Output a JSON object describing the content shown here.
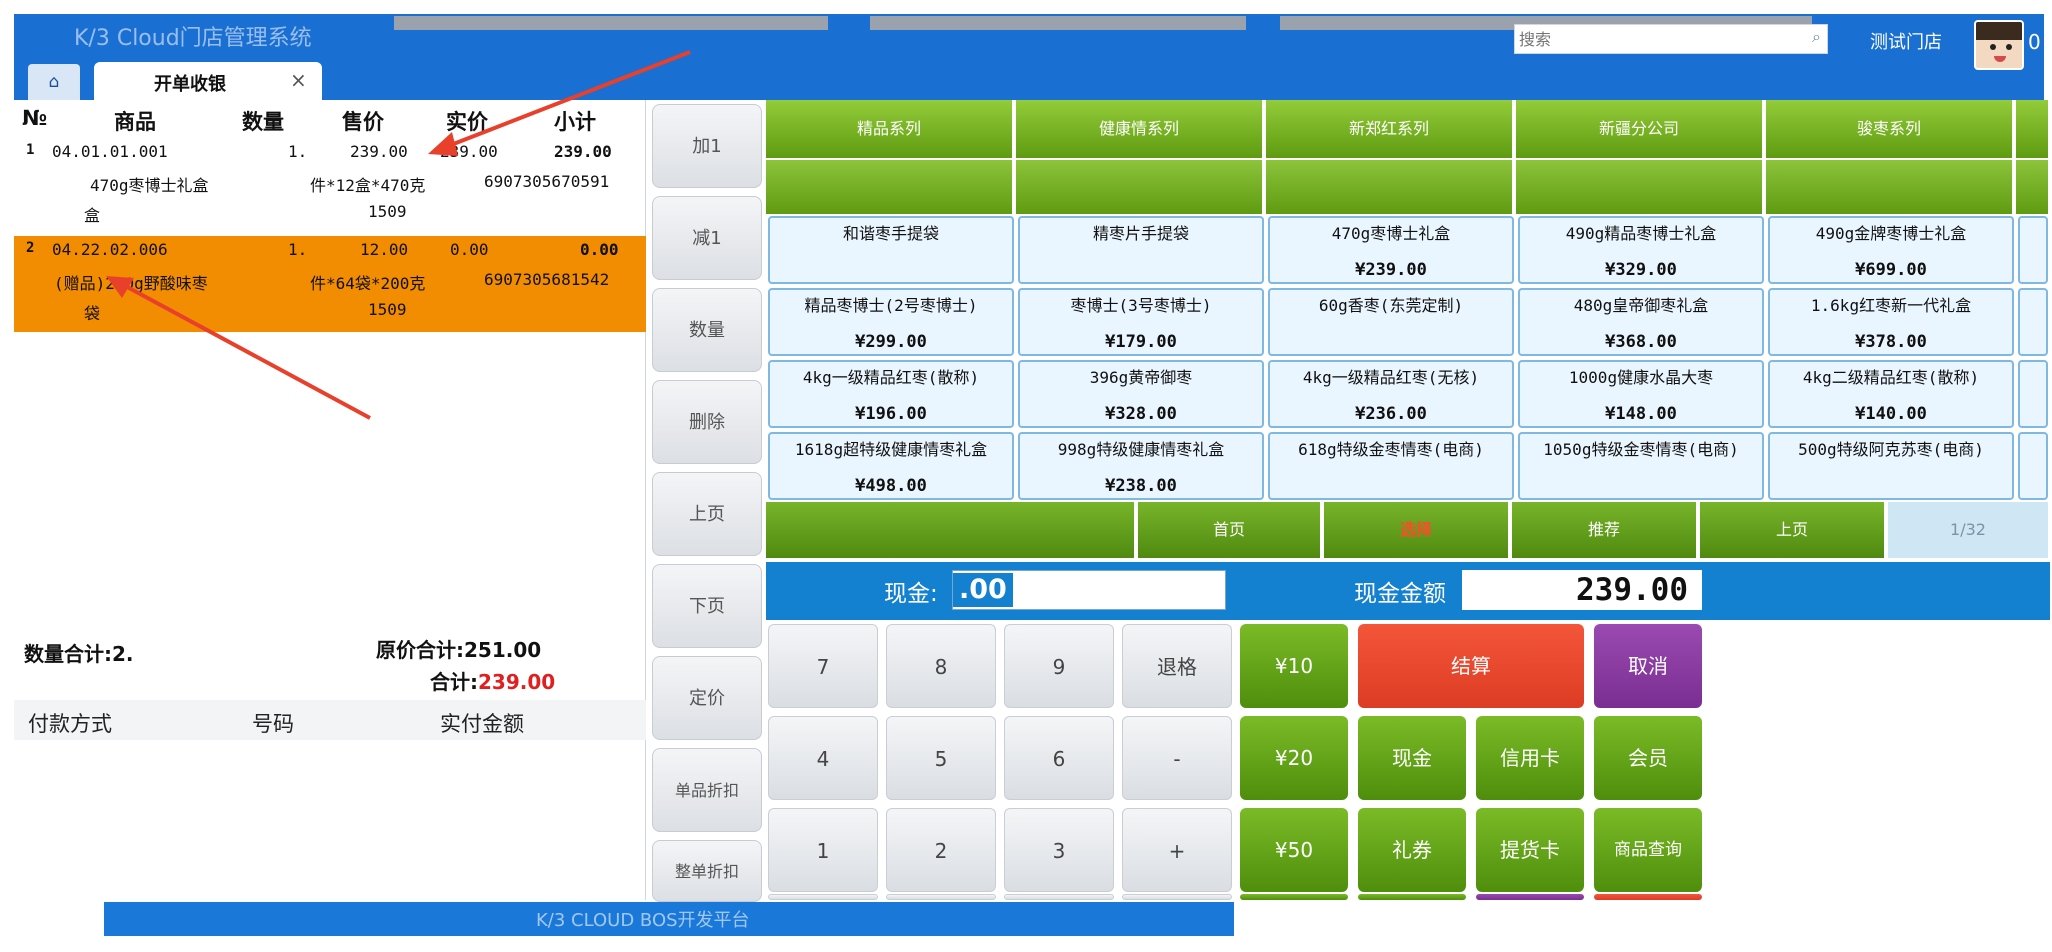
{
  "app": {
    "title": "K/3 Cloud门店管理系统",
    "store": "测试门店",
    "user_initial": "0"
  },
  "search": {
    "placeholder": "搜索"
  },
  "tabs": {
    "home": "⌂",
    "active": "开单收银",
    "close": "×"
  },
  "order": {
    "headers": {
      "no": "№",
      "product": "商品",
      "qty": "数量",
      "price": "售价",
      "actual": "实价",
      "subtotal": "小计"
    },
    "rows": [
      {
        "no": "1",
        "code": "04.01.01.001",
        "name_line1": "470g枣博士礼盒",
        "name_line2": "盒",
        "qty": "1.",
        "price": "239.00",
        "actual": "239.00",
        "subtotal": "239.00",
        "spec": "件*12盒*470克",
        "barcode": "6907305670591",
        "extra": "1509"
      },
      {
        "no": "2",
        "code": "04.22.02.006",
        "name_line1": "(赠品)200g野酸味枣",
        "name_line2": "袋",
        "qty": "1.",
        "price": "12.00",
        "actual": "0.00",
        "subtotal": "0.00",
        "spec": "件*64袋*200克",
        "barcode": "6907305681542",
        "extra": "1509"
      }
    ]
  },
  "summary": {
    "qty_total": "数量合计:2.",
    "orig_total_label": "原价合计:",
    "orig_total": "251.00",
    "total_label": "合计:",
    "total": "239.00"
  },
  "payment": {
    "headers": [
      "付款方式",
      "号码",
      "实付金额"
    ]
  },
  "functions": [
    "加1",
    "减1",
    "数量",
    "删除",
    "上页",
    "下页",
    "定价",
    "单品折扣",
    "整单折扣"
  ],
  "categories": [
    "精品系列",
    "健康情系列",
    "新郑红系列",
    "新疆分公司",
    "骏枣系列"
  ],
  "products": [
    {
      "name": "和谐枣手提袋",
      "price": ""
    },
    {
      "name": "精枣片手提袋",
      "price": ""
    },
    {
      "name": "470g枣博士礼盒",
      "price": "¥239.00"
    },
    {
      "name": "490g精品枣博士礼盒",
      "price": "¥329.00"
    },
    {
      "name": "490g金牌枣博士礼盒",
      "price": "¥699.00"
    },
    {
      "name": "精品枣博士(2号枣博士)",
      "price": "¥299.00"
    },
    {
      "name": "枣博士(3号枣博士)",
      "price": "¥179.00"
    },
    {
      "name": "60g香枣(东莞定制)",
      "price": ""
    },
    {
      "name": "480g皇帝御枣礼盒",
      "price": "¥368.00"
    },
    {
      "name": "1.6kg红枣新一代礼盒",
      "price": "¥378.00"
    },
    {
      "name": "4kg一级精品红枣(散称)",
      "price": "¥196.00"
    },
    {
      "name": "396g黄帝御枣",
      "price": "¥328.00"
    },
    {
      "name": "4kg一级精品红枣(无核)",
      "price": "¥236.00"
    },
    {
      "name": "1000g健康水晶大枣",
      "price": "¥148.00"
    },
    {
      "name": "4kg二级精品红枣(散称)",
      "price": "¥140.00"
    },
    {
      "name": "1618g超特级健康情枣礼盒",
      "price": "¥498.00"
    },
    {
      "name": "998g特级健康情枣礼盒",
      "price": "¥238.00"
    },
    {
      "name": "618g特级金枣情枣(电商)",
      "price": ""
    },
    {
      "name": "1050g特级金枣情枣(电商)",
      "price": ""
    },
    {
      "name": "500g特级阿克苏枣(电商)",
      "price": ""
    }
  ],
  "pager": {
    "first": "首页",
    "select": "选择",
    "recommend": "推荐",
    "prev": "上页",
    "count": "1/32"
  },
  "cash": {
    "cash_label": "现金:",
    "cash_value": ".00",
    "amount_label": "现金金额",
    "amount_value": "239.00"
  },
  "keypad": {
    "digits": [
      "7",
      "8",
      "9",
      "4",
      "5",
      "6",
      "1",
      "2",
      "3"
    ],
    "backspace": "退格",
    "minus": "-",
    "plus": "+",
    "quick": [
      "¥10",
      "¥20",
      "¥50"
    ],
    "checkout": "结算",
    "cancel": "取消",
    "cash": "现金",
    "credit": "信用卡",
    "member": "会员",
    "voucher": "礼券",
    "pickup": "提货卡",
    "lookup": "商品查询"
  },
  "footer": {
    "text": "K/3 CLOUD BOS开发平台"
  },
  "colors": {
    "header_blue": "#1a6fd2",
    "category_green": "#6aa81a",
    "selected_row": "#f28c00",
    "checkout_red": "#e8472d",
    "cancel_purple": "#8a3aa2",
    "total_red": "#e02020"
  }
}
